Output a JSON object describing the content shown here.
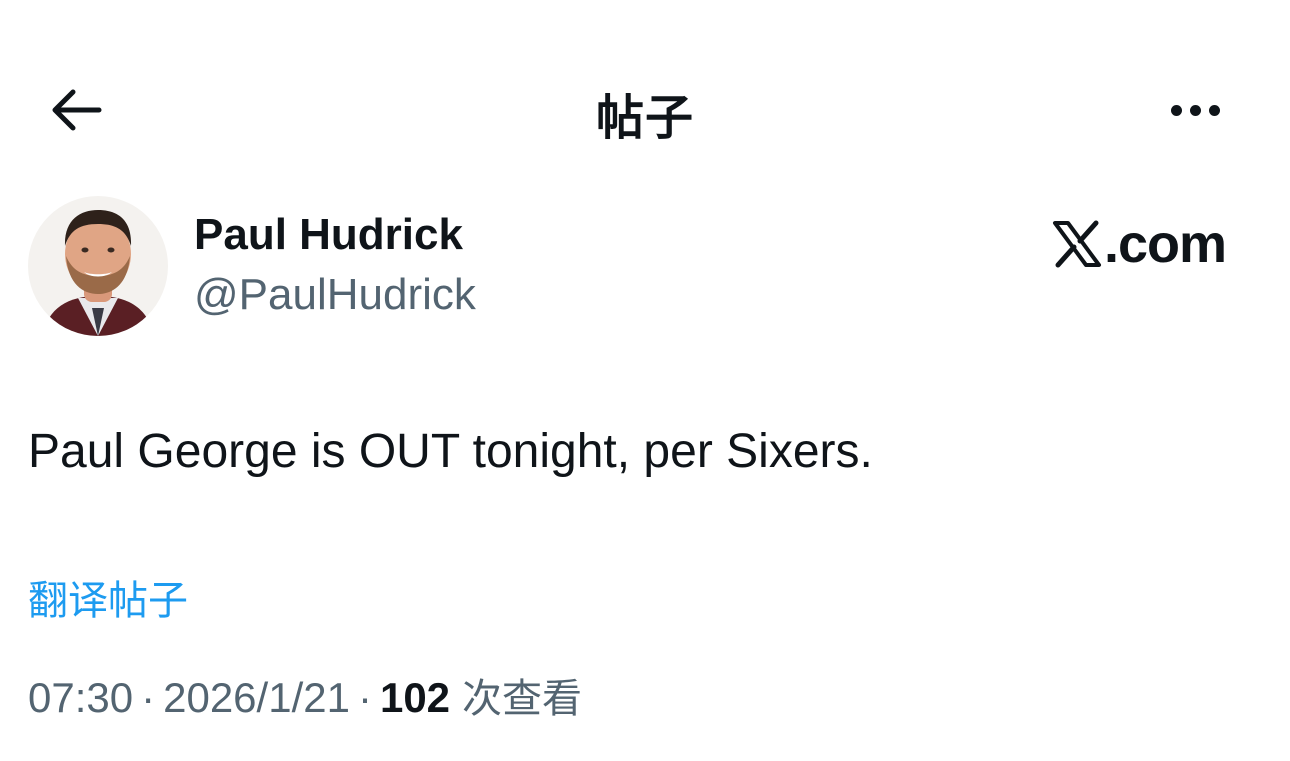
{
  "header": {
    "title": "帖子",
    "back_icon": "arrow-left-icon",
    "more_icon": "more-horizontal-icon"
  },
  "tweet": {
    "author": {
      "display_name": "Paul Hudrick",
      "handle": "@PaulHudrick",
      "avatar_icon": "profile-photo"
    },
    "watermark": {
      "logo_icon": "x-logo-icon",
      "text": ".com"
    },
    "text": "Paul George is OUT tonight, per Sixers.",
    "translate_label": "翻译帖子",
    "time": "07:30",
    "date": "2026/1/21",
    "separator": "·",
    "views_count": "102",
    "views_label": "次查看"
  },
  "colors": {
    "text_primary": "#0f1419",
    "text_secondary": "#536471",
    "link": "#1d9bf0",
    "background": "#ffffff"
  }
}
